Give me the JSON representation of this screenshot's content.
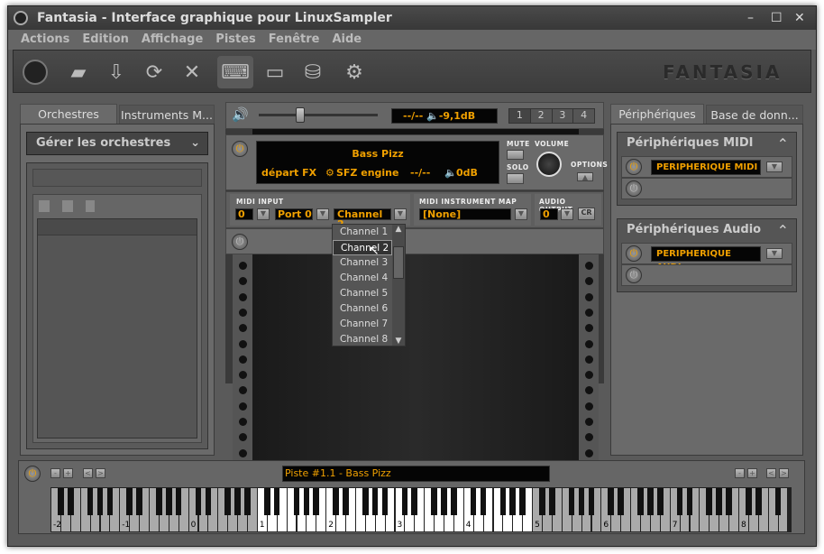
{
  "window": {
    "title": "Fantasia - Interface graphique pour LinuxSampler",
    "controls": [
      "–",
      "☐",
      "✕"
    ]
  },
  "menu": [
    "Actions",
    "Edition",
    "Affichage",
    "Pistes",
    "Fenêtre",
    "Aide"
  ],
  "toolbar": {
    "icons": [
      "linuxsampler-logo-icon",
      "open-folder-icon",
      "save-icon",
      "refresh-icon",
      "close-x-icon",
      "keyboard-icon",
      "monitor-icon",
      "database-icon",
      "network-settings-icon"
    ],
    "brand": "FANTASIA"
  },
  "left": {
    "tabs": [
      "Orchestres",
      "Instruments M..."
    ],
    "manage": "Gérer les orchestres"
  },
  "master": {
    "meter": "--/--",
    "volume": "-9,1dB",
    "tabs": [
      "1",
      "2",
      "3",
      "4"
    ],
    "volume_level": 0.2
  },
  "channel": {
    "instrument": "Bass Pizz",
    "fx": "départ FX",
    "engine": "SFZ engine",
    "meter": "--/--",
    "volume": "0dB",
    "mute": "MUTE",
    "solo": "SOLO",
    "volume_label": "VOLUME",
    "options": "OPTIONS"
  },
  "midi": {
    "input_label": "MIDI INPUT",
    "device": "0",
    "port": "Port 0",
    "channel": "Channel 2",
    "map_label": "MIDI INSTRUMENT MAP",
    "map": "[None]",
    "audio_label": "AUDIO OUTPUT",
    "audio": "0",
    "cr": "CR"
  },
  "channel_list": [
    "Channel 1",
    "Channel 2",
    "Channel 3",
    "Channel 4",
    "Channel 5",
    "Channel 6",
    "Channel 7",
    "Channel 8"
  ],
  "right": {
    "tabs": [
      "Périphériques",
      "Base de donn..."
    ],
    "midi_title": "Périphériques MIDI",
    "midi_device": "PERIPHERIQUE MIDI ...",
    "audio_title": "Périphériques Audio",
    "audio_device": "PERIPHERIQUE AUDI..."
  },
  "piano": {
    "track": "Piste #1.1 - Bass Pizz",
    "octaves": [
      "-2",
      "-1",
      "0",
      "1",
      "2",
      "3",
      "4",
      "5",
      "6",
      "7",
      "8"
    ],
    "buttons": [
      "-",
      "+",
      "<",
      ">"
    ]
  },
  "colors": {
    "accent": "#f0a000",
    "bg": "#5a5a5a"
  }
}
